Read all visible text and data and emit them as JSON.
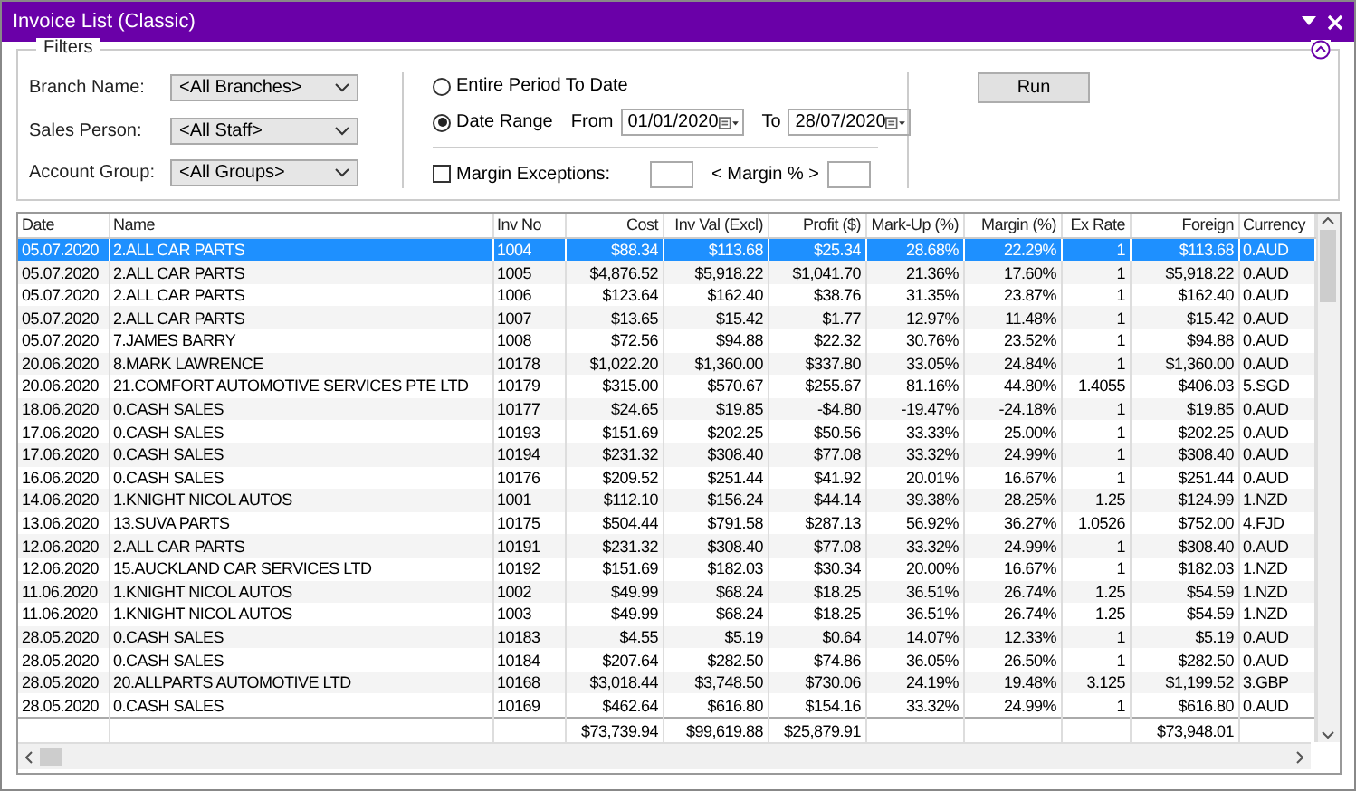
{
  "window": {
    "title": "Invoice List (Classic)"
  },
  "filters": {
    "title": "Filters",
    "combos": [
      {
        "label": "Branch Name:",
        "value": "<All Branches>"
      },
      {
        "label": "Sales Person:",
        "value": "<All Staff>"
      },
      {
        "label": "Account Group:",
        "value": "<All Groups>"
      }
    ],
    "period_options": [
      {
        "label": "Entire Period To Date",
        "selected": false
      },
      {
        "label": "Date Range",
        "selected": true
      }
    ],
    "from_label": "From",
    "from_date": "01/01/2020",
    "to_label": "To",
    "to_date": "28/07/2020",
    "margin_exceptions": {
      "label": "Margin Exceptions:",
      "checked": false
    },
    "margin_label": "< Margin % >",
    "run_button": "Run"
  },
  "table": {
    "columns": [
      "Date",
      "Name",
      "Inv No",
      "Cost",
      "Inv Val (Excl)",
      "Profit ($)",
      "Mark-Up (%)",
      "Margin (%)",
      "Ex Rate",
      "Foreign",
      "Currency"
    ],
    "rows": [
      {
        "selected": true,
        "cells": [
          "05.07.2020",
          "2.ALL CAR PARTS",
          "1004",
          "$88.34",
          "$113.68",
          "$25.34",
          "28.68%",
          "22.29%",
          "1",
          "$113.68",
          "0.AUD"
        ]
      },
      {
        "selected": false,
        "cells": [
          "05.07.2020",
          "2.ALL CAR PARTS",
          "1005",
          "$4,876.52",
          "$5,918.22",
          "$1,041.70",
          "21.36%",
          "17.60%",
          "1",
          "$5,918.22",
          "0.AUD"
        ]
      },
      {
        "selected": false,
        "cells": [
          "05.07.2020",
          "2.ALL CAR PARTS",
          "1006",
          "$123.64",
          "$162.40",
          "$38.76",
          "31.35%",
          "23.87%",
          "1",
          "$162.40",
          "0.AUD"
        ]
      },
      {
        "selected": false,
        "cells": [
          "05.07.2020",
          "2.ALL CAR PARTS",
          "1007",
          "$13.65",
          "$15.42",
          "$1.77",
          "12.97%",
          "11.48%",
          "1",
          "$15.42",
          "0.AUD"
        ]
      },
      {
        "selected": false,
        "cells": [
          "05.07.2020",
          "7.JAMES BARRY",
          "1008",
          "$72.56",
          "$94.88",
          "$22.32",
          "30.76%",
          "23.52%",
          "1",
          "$94.88",
          "0.AUD"
        ]
      },
      {
        "selected": false,
        "cells": [
          "20.06.2020",
          "8.MARK LAWRENCE",
          "10178",
          "$1,022.20",
          "$1,360.00",
          "$337.80",
          "33.05%",
          "24.84%",
          "1",
          "$1,360.00",
          "0.AUD"
        ]
      },
      {
        "selected": false,
        "cells": [
          "20.06.2020",
          "21.COMFORT AUTOMOTIVE SERVICES PTE LTD",
          "10179",
          "$315.00",
          "$570.67",
          "$255.67",
          "81.16%",
          "44.80%",
          "1.4055",
          "$406.03",
          "5.SGD"
        ]
      },
      {
        "selected": false,
        "cells": [
          "18.06.2020",
          "0.CASH SALES",
          "10177",
          "$24.65",
          "$19.85",
          "-$4.80",
          "-19.47%",
          "-24.18%",
          "1",
          "$19.85",
          "0.AUD"
        ]
      },
      {
        "selected": false,
        "cells": [
          "17.06.2020",
          "0.CASH SALES",
          "10193",
          "$151.69",
          "$202.25",
          "$50.56",
          "33.33%",
          "25.00%",
          "1",
          "$202.25",
          "0.AUD"
        ]
      },
      {
        "selected": false,
        "cells": [
          "17.06.2020",
          "0.CASH SALES",
          "10194",
          "$231.32",
          "$308.40",
          "$77.08",
          "33.32%",
          "24.99%",
          "1",
          "$308.40",
          "0.AUD"
        ]
      },
      {
        "selected": false,
        "cells": [
          "16.06.2020",
          "0.CASH SALES",
          "10176",
          "$209.52",
          "$251.44",
          "$41.92",
          "20.01%",
          "16.67%",
          "1",
          "$251.44",
          "0.AUD"
        ]
      },
      {
        "selected": false,
        "cells": [
          "14.06.2020",
          "1.KNIGHT NICOL AUTOS",
          "1001",
          "$112.10",
          "$156.24",
          "$44.14",
          "39.38%",
          "28.25%",
          "1.25",
          "$124.99",
          "1.NZD"
        ]
      },
      {
        "selected": false,
        "cells": [
          "13.06.2020",
          "13.SUVA PARTS",
          "10175",
          "$504.44",
          "$791.58",
          "$287.13",
          "56.92%",
          "36.27%",
          "1.0526",
          "$752.00",
          "4.FJD"
        ]
      },
      {
        "selected": false,
        "cells": [
          "12.06.2020",
          "2.ALL CAR PARTS",
          "10191",
          "$231.32",
          "$308.40",
          "$77.08",
          "33.32%",
          "24.99%",
          "1",
          "$308.40",
          "0.AUD"
        ]
      },
      {
        "selected": false,
        "cells": [
          "12.06.2020",
          "15.AUCKLAND CAR SERVICES LTD",
          "10192",
          "$151.69",
          "$182.03",
          "$30.34",
          "20.00%",
          "16.67%",
          "1",
          "$182.03",
          "1.NZD"
        ]
      },
      {
        "selected": false,
        "cells": [
          "11.06.2020",
          "1.KNIGHT NICOL AUTOS",
          "1002",
          "$49.99",
          "$68.24",
          "$18.25",
          "36.51%",
          "26.74%",
          "1.25",
          "$54.59",
          "1.NZD"
        ]
      },
      {
        "selected": false,
        "cells": [
          "11.06.2020",
          "1.KNIGHT NICOL AUTOS",
          "1003",
          "$49.99",
          "$68.24",
          "$18.25",
          "36.51%",
          "26.74%",
          "1.25",
          "$54.59",
          "1.NZD"
        ]
      },
      {
        "selected": false,
        "cells": [
          "28.05.2020",
          "0.CASH SALES",
          "10183",
          "$4.55",
          "$5.19",
          "$0.64",
          "14.07%",
          "12.33%",
          "1",
          "$5.19",
          "0.AUD"
        ]
      },
      {
        "selected": false,
        "cells": [
          "28.05.2020",
          "0.CASH SALES",
          "10184",
          "$207.64",
          "$282.50",
          "$74.86",
          "36.05%",
          "26.50%",
          "1",
          "$282.50",
          "0.AUD"
        ]
      },
      {
        "selected": false,
        "cells": [
          "28.05.2020",
          "20.ALLPARTS AUTOMOTIVE LTD",
          "10168",
          "$3,018.44",
          "$3,748.50",
          "$730.06",
          "24.19%",
          "19.48%",
          "3.125",
          "$1,199.52",
          "3.GBP"
        ]
      },
      {
        "selected": false,
        "cells": [
          "28.05.2020",
          "0.CASH SALES",
          "10169",
          "$462.64",
          "$616.80",
          "$154.16",
          "33.32%",
          "24.99%",
          "1",
          "$616.80",
          "0.AUD"
        ]
      }
    ],
    "totals": {
      "cost": "$73,739.94",
      "inv_val": "$99,619.88",
      "profit": "$25,879.91",
      "foreign": "$73,948.01"
    }
  }
}
